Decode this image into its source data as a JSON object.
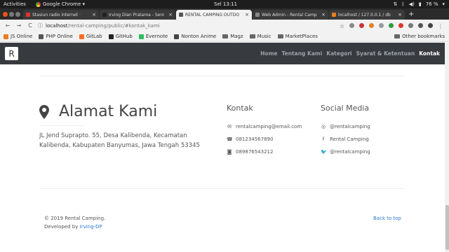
{
  "system_bar": {
    "activities": "Activities",
    "app": "Google Chrome ▾",
    "clock": "Sel 13:11",
    "battery": "76 %"
  },
  "tabs": [
    {
      "title": "Stasiun radio internet ·",
      "fav_color": "#d33",
      "active": false
    },
    {
      "title": "Irving Dian Pratama - Seni",
      "fav_color": "#222",
      "active": false
    },
    {
      "title": "RENTAL CAMPING OUTDO",
      "fav_color": "#555",
      "active": true
    },
    {
      "title": "Web Admin - Rental Camp",
      "fav_color": "#888",
      "active": false
    },
    {
      "title": "localhost / 127.0.0.1 / db",
      "fav_color": "#e67e22",
      "active": false
    }
  ],
  "address_bar": {
    "host": "localhost",
    "path": "/rental-camping/public/#kontak_kami"
  },
  "bookmarks": [
    {
      "label": "JS Online",
      "icon": "js-icon",
      "color": "#e67e22"
    },
    {
      "label": "PHP Online",
      "icon": "php-icon",
      "color": "#555"
    },
    {
      "label": "GitLab",
      "icon": "gitlab-icon",
      "color": "#fc6d26"
    },
    {
      "label": "GitHub",
      "icon": "github-icon",
      "color": "#222"
    },
    {
      "label": "Evernote",
      "icon": "evernote-icon",
      "color": "#2dbe60"
    },
    {
      "label": "Nonton Anime",
      "icon": "anime-icon",
      "color": "#444"
    },
    {
      "label": "Magz",
      "icon": "folder-icon",
      "color": "#666"
    },
    {
      "label": "Music",
      "icon": "folder-icon",
      "color": "#666"
    },
    {
      "label": "MarketPlaces",
      "icon": "folder-icon",
      "color": "#666"
    }
  ],
  "other_bookmarks": "Other bookmarks",
  "site": {
    "brand": "R",
    "menu": [
      "Home",
      "Tentang Kami",
      "Kategori",
      "Syarat & Ketentuan",
      "Kontak"
    ],
    "active_menu": "Kontak"
  },
  "address": {
    "title": "Alamat Kami",
    "text": "JL Jend Suprapto. 55, Desa Kalibenda, Kecamatan Kalibenda, Kabupaten Banyumas, Jawa Tengah 53345"
  },
  "contact": {
    "title": "Kontak",
    "items": [
      {
        "icon": "envelope-icon",
        "glyph": "✉",
        "text": "rentalcamping@email.com"
      },
      {
        "icon": "phone-icon",
        "glyph": "☎",
        "text": "081234567890"
      },
      {
        "icon": "whatsapp-icon",
        "glyph": "◙",
        "text": "089876543212"
      }
    ]
  },
  "social": {
    "title": "Social Media",
    "items": [
      {
        "icon": "instagram-icon",
        "glyph": "◎",
        "text": "@rentalcamping"
      },
      {
        "icon": "facebook-icon",
        "glyph": "f",
        "text": "Rental Camping"
      },
      {
        "icon": "twitter-icon",
        "glyph": "🐦",
        "text": "@rentalcamping"
      }
    ]
  },
  "footer": {
    "copyright": "© 2019 Rental Camping.",
    "developed_by": "Developed by",
    "developer": "Irving-DP",
    "back_to_top": "Back to top"
  },
  "colors": {
    "navbar": "#373a3e",
    "link": "#2a7ad0",
    "text": "#555555"
  }
}
